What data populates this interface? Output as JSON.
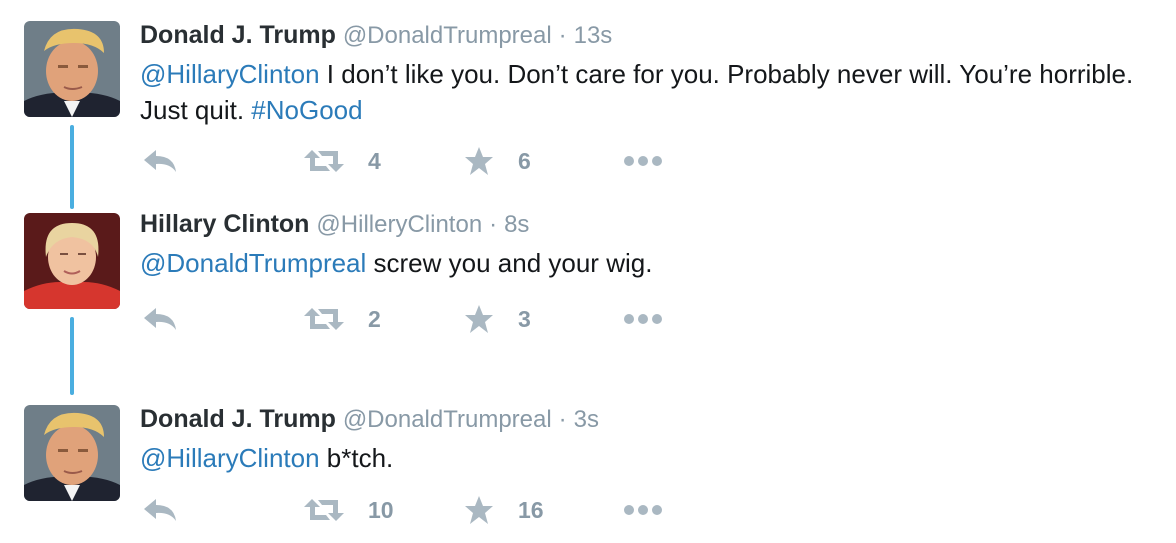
{
  "tweets": [
    {
      "name": "Donald J. Trump",
      "handle": "@DonaldTrumpreal",
      "separator": "·",
      "time": "13s",
      "mention": "@HillaryClinton",
      "text": " I don’t like you. Don’t care for you. Probably never will. You’re horrible. Just quit. ",
      "hashtag": "#NoGood",
      "retweets": "4",
      "likes": "6"
    },
    {
      "name": "Hillary Clinton",
      "handle": "@HilleryClinton",
      "separator": "·",
      "time": "8s",
      "mention": "@DonaldTrumpreal",
      "text": " screw you and your wig.",
      "hashtag": "",
      "retweets": "2",
      "likes": "3"
    },
    {
      "name": "Donald J. Trump",
      "handle": "@DonaldTrumpreal",
      "separator": "·",
      "time": "3s",
      "mention": "@HillaryClinton",
      "text": " b*tch.",
      "hashtag": "",
      "retweets": "10",
      "likes": "16"
    }
  ],
  "icons": {
    "reply": "reply-icon",
    "retweet": "retweet-icon",
    "like": "star-icon",
    "more": "more-icon"
  },
  "colors": {
    "link": "#2b7bb9",
    "muted": "#8899a6",
    "icon": "#aab8c2",
    "thread": "#4aaee0"
  }
}
